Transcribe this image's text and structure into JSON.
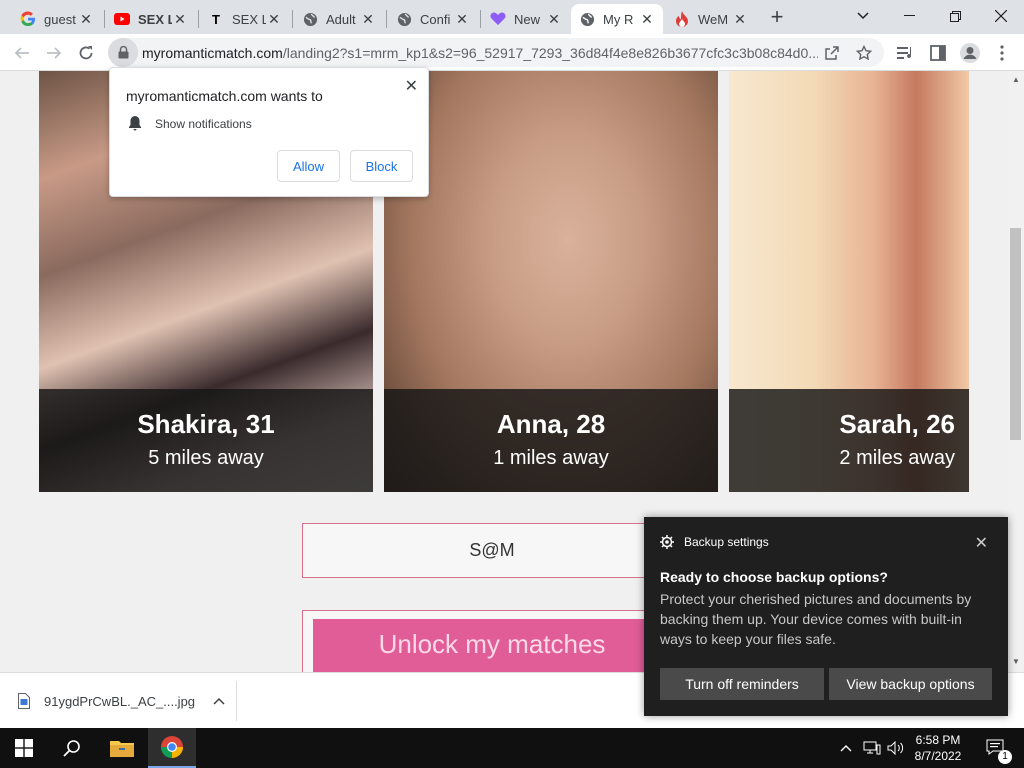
{
  "browser": {
    "tabs": [
      {
        "title": "guest",
        "favicon": "google-icon",
        "active": false
      },
      {
        "title": "SEX L",
        "favicon": "youtube-icon",
        "active": false
      },
      {
        "title": "SEX L",
        "favicon": "t-icon",
        "active": false
      },
      {
        "title": "Adult",
        "favicon": "globe-icon",
        "active": false
      },
      {
        "title": "Confi",
        "favicon": "globe-icon",
        "active": false
      },
      {
        "title": "New",
        "favicon": "heart-icon",
        "active": false
      },
      {
        "title": "My R",
        "favicon": "globe-icon",
        "active": true
      },
      {
        "title": "WeM",
        "favicon": "flame-icon",
        "active": false
      }
    ],
    "url_host": "myromanticmatch.com",
    "url_rest": "/landing2?s1=mrm_kp1&s2=96_52917_7293_36d84f4e8e826b3677cfc3c3b08c84d0..."
  },
  "permission_popup": {
    "title": "myromanticmatch.com wants to",
    "row": "Show notifications",
    "allow": "Allow",
    "block": "Block"
  },
  "profiles": [
    {
      "name": "Shakira, 31",
      "distance": "5 miles away"
    },
    {
      "name": "Anna, 28",
      "distance": "1 miles away"
    },
    {
      "name": "Sarah, 26",
      "distance": "2 miles away"
    }
  ],
  "page": {
    "sam_label": "S@M",
    "unlock_label": "Unlock my matches"
  },
  "download": {
    "filename": "91ygdPrCwBL._AC_....jpg"
  },
  "toast": {
    "app": "Backup settings",
    "heading": "Ready to choose backup options?",
    "body": "Protect your cherished pictures and documents by backing them up. Your device comes with built-in ways to keep your files safe.",
    "btn_off": "Turn off reminders",
    "btn_view": "View backup options"
  },
  "taskbar": {
    "time": "6:58 PM",
    "date": "8/7/2022",
    "notif_count": "1"
  },
  "colors": {
    "accent_pink": "#e05d97",
    "border_pink": "#d9708e",
    "link_blue": "#1a73e8"
  }
}
